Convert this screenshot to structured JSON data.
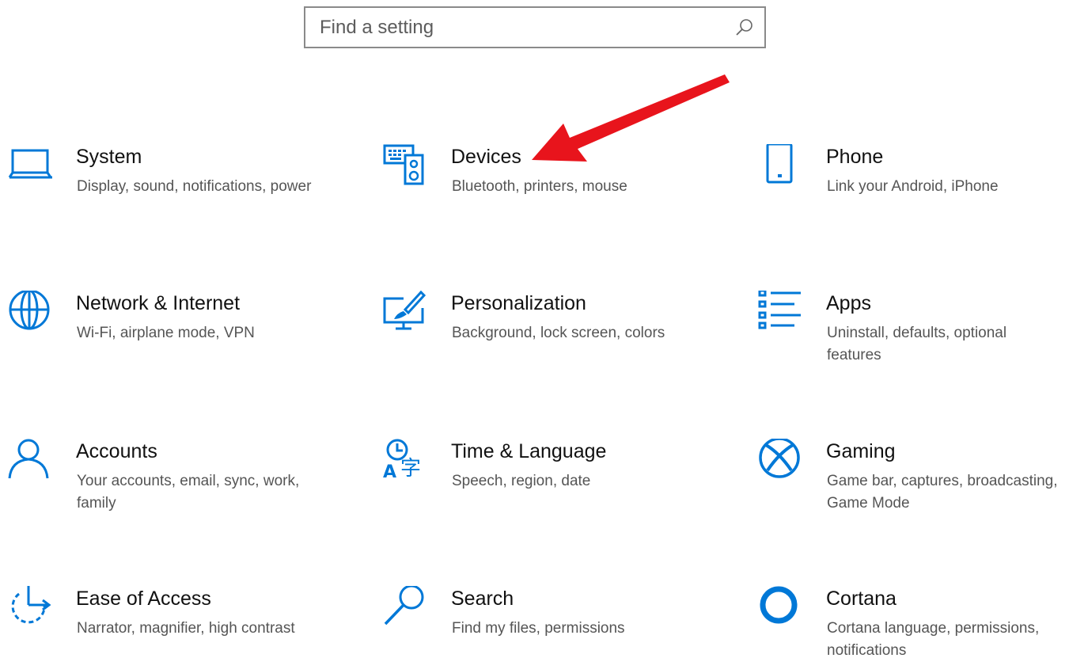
{
  "search": {
    "placeholder": "Find a setting",
    "icon": "search-icon"
  },
  "accent_color": "#0078d7",
  "annotation_color": "#e8141c",
  "tiles": [
    {
      "id": "system",
      "title": "System",
      "desc": "Display, sound, notifications, power",
      "icon": "laptop-icon"
    },
    {
      "id": "devices",
      "title": "Devices",
      "desc": "Bluetooth, printers, mouse",
      "icon": "devices-icon"
    },
    {
      "id": "phone",
      "title": "Phone",
      "desc": "Link your Android, iPhone",
      "icon": "phone-icon"
    },
    {
      "id": "network",
      "title": "Network & Internet",
      "desc": "Wi-Fi, airplane mode, VPN",
      "icon": "globe-icon"
    },
    {
      "id": "personalization",
      "title": "Personalization",
      "desc": "Background, lock screen, colors",
      "icon": "paint-brush-icon"
    },
    {
      "id": "apps",
      "title": "Apps",
      "desc": "Uninstall, defaults, optional features",
      "icon": "apps-list-icon"
    },
    {
      "id": "accounts",
      "title": "Accounts",
      "desc": "Your accounts, email, sync, work, family",
      "icon": "person-icon"
    },
    {
      "id": "time-language",
      "title": "Time & Language",
      "desc": "Speech, region, date",
      "icon": "time-language-icon"
    },
    {
      "id": "gaming",
      "title": "Gaming",
      "desc": "Game bar, captures, broadcasting, Game Mode",
      "icon": "xbox-icon"
    },
    {
      "id": "ease-of-access",
      "title": "Ease of Access",
      "desc": "Narrator, magnifier, high contrast",
      "icon": "ease-of-access-icon"
    },
    {
      "id": "search",
      "title": "Search",
      "desc": "Find my files, permissions",
      "icon": "magnifier-icon"
    },
    {
      "id": "cortana",
      "title": "Cortana",
      "desc": "Cortana language, permissions, notifications",
      "icon": "cortana-icon"
    }
  ]
}
